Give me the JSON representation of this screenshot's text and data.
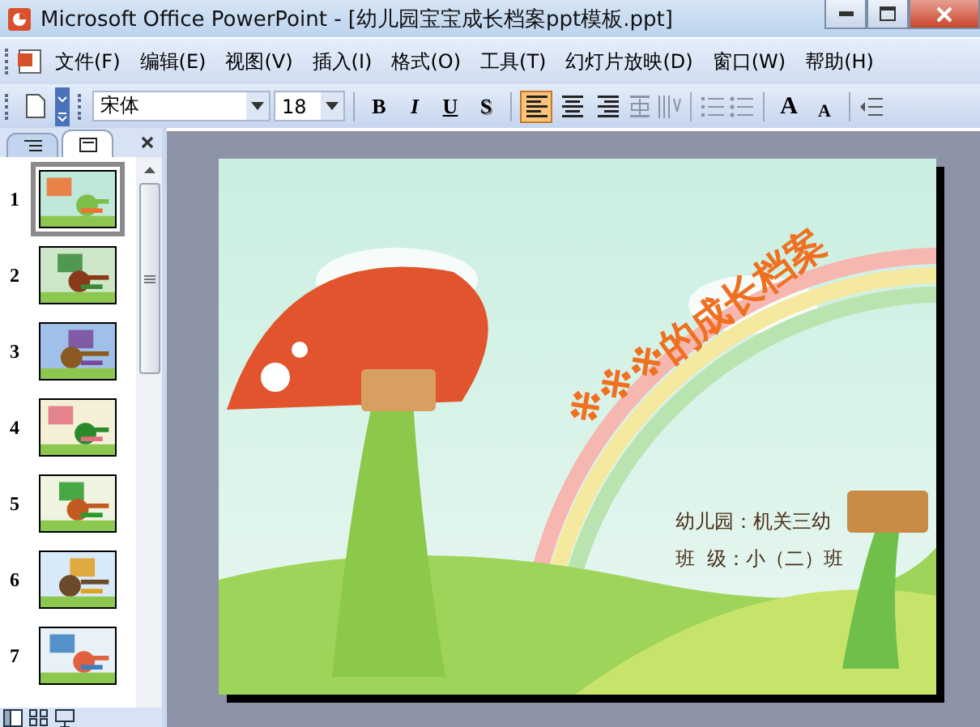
{
  "window": {
    "title": "Microsoft Office PowerPoint - [幼儿园宝宝成长档案ppt模板.ppt]"
  },
  "menu": [
    "文件(F)",
    "编辑(E)",
    "视图(V)",
    "插入(I)",
    "格式(O)",
    "工具(T)",
    "幻灯片放映(D)",
    "窗口(W)",
    "帮助(H)"
  ],
  "toolbar": {
    "font": "宋体",
    "size": "18",
    "styles": [
      {
        "label": "B",
        "kind": "bold"
      },
      {
        "label": "I",
        "kind": "italic"
      },
      {
        "label": "U",
        "kind": "underline"
      },
      {
        "label": "S",
        "kind": "shadow"
      }
    ],
    "align": [
      {
        "kind": "left",
        "selected": true
      },
      {
        "kind": "center",
        "selected": false
      },
      {
        "kind": "right",
        "selected": false
      }
    ],
    "sizes": [
      {
        "label": "A",
        "kind": "grow"
      },
      {
        "label": "A",
        "kind": "shrink"
      }
    ]
  },
  "panel": {
    "tabs": [
      {
        "kind": "outline",
        "selected": false
      },
      {
        "kind": "slides",
        "selected": true
      }
    ],
    "slides": [
      {
        "number": "1",
        "selected": true
      },
      {
        "number": "2",
        "selected": false
      },
      {
        "number": "3",
        "selected": false
      },
      {
        "number": "4",
        "selected": false
      },
      {
        "number": "5",
        "selected": false
      },
      {
        "number": "6",
        "selected": false
      },
      {
        "number": "7",
        "selected": false
      }
    ]
  },
  "slide": {
    "title": "※※※的成长档案",
    "lines": [
      "幼儿园：机关三幼",
      "班  级：小（二）班"
    ]
  }
}
